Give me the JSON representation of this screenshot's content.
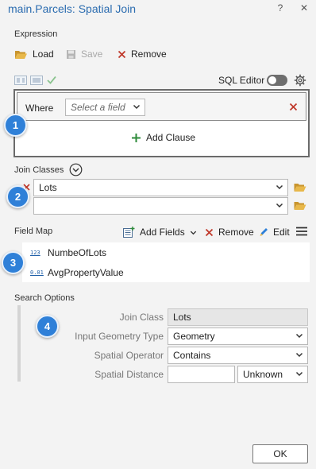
{
  "window": {
    "title": "main.Parcels: Spatial Join",
    "help": "?",
    "close": "✕"
  },
  "expression": {
    "label": "Expression",
    "load": "Load",
    "save": "Save",
    "remove": "Remove",
    "sql_editor": "SQL Editor",
    "where_label": "Where",
    "field_placeholder": "Select a field",
    "add_clause": "Add Clause"
  },
  "join_classes": {
    "label": "Join Classes",
    "rows": [
      {
        "value": "Lots"
      },
      {
        "value": ""
      }
    ]
  },
  "field_map": {
    "label": "Field Map",
    "add_fields": "Add Fields",
    "remove": "Remove",
    "edit": "Edit",
    "fields": [
      {
        "type_icon": "123",
        "name": "NumbeOfLots"
      },
      {
        "type_icon": "0.01",
        "name": "AvgPropertyValue"
      }
    ]
  },
  "search_options": {
    "label": "Search Options",
    "join_class_label": "Join Class",
    "join_class_value": "Lots",
    "input_geometry_label": "Input Geometry Type",
    "input_geometry_value": "Geometry",
    "spatial_operator_label": "Spatial Operator",
    "spatial_operator_value": "Contains",
    "spatial_distance_label": "Spatial Distance",
    "spatial_distance_value": "",
    "distance_unit": "Unknown"
  },
  "badges": [
    "1",
    "2",
    "3",
    "4"
  ],
  "ok": "OK",
  "colors": {
    "accent": "#2f80d8",
    "title": "#2b6cb0",
    "remove_x": "#c0392b",
    "add_green": "#2e8b3a",
    "folder": "#e8b84a"
  }
}
